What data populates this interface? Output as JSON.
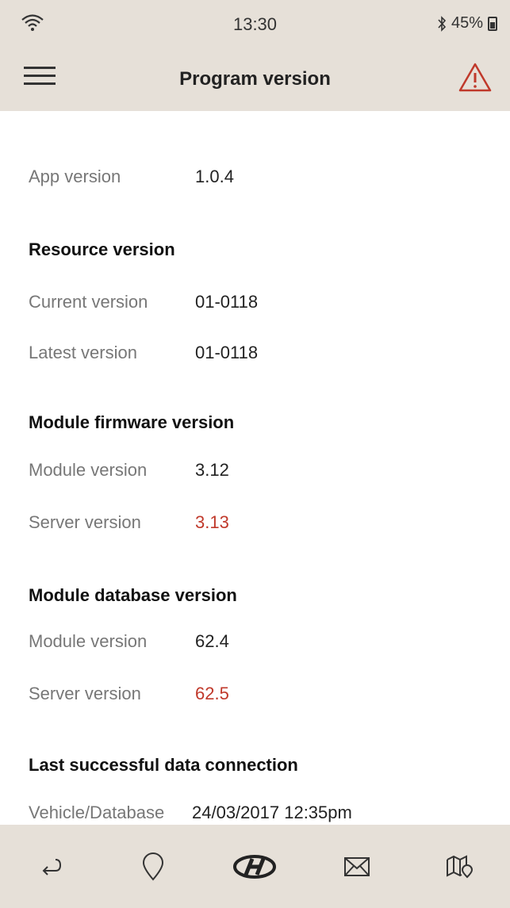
{
  "status_bar": {
    "time": "13:30",
    "battery": "45%",
    "bluetooth_icon": "bluetooth-icon",
    "wifi_icon": "wifi-icon"
  },
  "header": {
    "title": "Program version",
    "menu_icon": "hamburger-menu-icon",
    "alert_icon": "warning-icon"
  },
  "app_version": {
    "label": "App version",
    "value": "1.0.4"
  },
  "resource": {
    "title": "Resource version",
    "current_label": "Current version",
    "current_value": "01-0118",
    "latest_label": "Latest version",
    "latest_value": "01-0118"
  },
  "firmware": {
    "title": "Module firmware version",
    "module_label": "Module version",
    "module_value": "3.12",
    "server_label": "Server version",
    "server_value": "3.13"
  },
  "database": {
    "title": "Module database version",
    "module_label": "Module version",
    "module_value": "62.4",
    "server_label": "Server version",
    "server_value": "62.5"
  },
  "connection": {
    "title": "Last successful data connection",
    "label": "Vehicle/Database",
    "value": "24/03/2017 12:35pm"
  },
  "bottom_nav": {
    "items": [
      "back-icon",
      "location-pin-icon",
      "brand-logo-icon",
      "mail-icon",
      "map-icon"
    ]
  },
  "colors": {
    "bar_background": "#e6e0d8",
    "highlight": "#c0392b",
    "alert": "#c0392b"
  }
}
